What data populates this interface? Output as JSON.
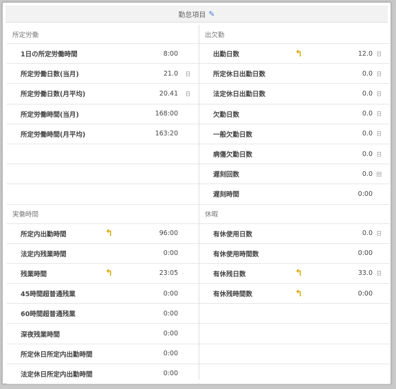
{
  "header": {
    "title": "勤怠項目"
  },
  "left": {
    "section1": {
      "title": "所定労働",
      "rows": [
        {
          "label": "1日の所定労働時間",
          "value": "8:00",
          "unit": "",
          "arrow": false
        },
        {
          "label": "所定労働日数(当月)",
          "value": "21.0",
          "unit": "日",
          "arrow": false
        },
        {
          "label": "所定労働日数(月平均)",
          "value": "20.41",
          "unit": "日",
          "arrow": false
        },
        {
          "label": "所定労働時間(当月)",
          "value": "168:00",
          "unit": "",
          "arrow": false
        },
        {
          "label": "所定労働時間(月平均)",
          "value": "163:20",
          "unit": "",
          "arrow": false
        },
        {
          "label": "",
          "value": "",
          "unit": "",
          "arrow": false
        },
        {
          "label": "",
          "value": "",
          "unit": "",
          "arrow": false
        },
        {
          "label": "",
          "value": "",
          "unit": "",
          "arrow": false
        }
      ]
    },
    "section2": {
      "title": "実働時間",
      "rows": [
        {
          "label": "所定内出勤時間",
          "value": "96:00",
          "unit": "",
          "arrow": true
        },
        {
          "label": "法定内残業時間",
          "value": "0:00",
          "unit": "",
          "arrow": false
        },
        {
          "label": "残業時間",
          "value": "23:05",
          "unit": "",
          "arrow": true
        },
        {
          "label": "45時間超普通残業",
          "value": "0:00",
          "unit": "",
          "arrow": false
        },
        {
          "label": "60時間超普通残業",
          "value": "0:00",
          "unit": "",
          "arrow": false
        },
        {
          "label": "深夜残業時間",
          "value": "0:00",
          "unit": "",
          "arrow": false
        },
        {
          "label": "所定休日所定内出勤時間",
          "value": "0:00",
          "unit": "",
          "arrow": false
        },
        {
          "label": "法定休日所定内出勤時間",
          "value": "0:00",
          "unit": "",
          "arrow": false
        }
      ]
    }
  },
  "right": {
    "section1": {
      "title": "出欠勤",
      "rows": [
        {
          "label": "出勤日数",
          "value": "12.0",
          "unit": "日",
          "arrow": true
        },
        {
          "label": "所定休日出勤日数",
          "value": "0.0",
          "unit": "日",
          "arrow": false
        },
        {
          "label": "法定休日出勤日数",
          "value": "0.0",
          "unit": "日",
          "arrow": false
        },
        {
          "label": "欠勤日数",
          "value": "0.0",
          "unit": "日",
          "arrow": false
        },
        {
          "label": "一般欠勤日数",
          "value": "0.0",
          "unit": "日",
          "arrow": false
        },
        {
          "label": "病傷欠勤日数",
          "value": "0.0",
          "unit": "日",
          "arrow": false
        },
        {
          "label": "遅刻回数",
          "value": "0.0",
          "unit": "回",
          "arrow": false
        },
        {
          "label": "遅刻時間",
          "value": "0:00",
          "unit": "",
          "arrow": false
        }
      ]
    },
    "section2": {
      "title": "休暇",
      "rows": [
        {
          "label": "有休使用日数",
          "value": "0.0",
          "unit": "日",
          "arrow": false
        },
        {
          "label": "有休使用時間数",
          "value": "0:00",
          "unit": "",
          "arrow": false
        },
        {
          "label": "有休残日数",
          "value": "33.0",
          "unit": "日",
          "arrow": true
        },
        {
          "label": "有休残時間数",
          "value": "0:00",
          "unit": "",
          "arrow": true
        },
        {
          "label": "",
          "value": "",
          "unit": "",
          "arrow": false
        },
        {
          "label": "",
          "value": "",
          "unit": "",
          "arrow": false
        },
        {
          "label": "",
          "value": "",
          "unit": "",
          "arrow": false
        },
        {
          "label": "",
          "value": "",
          "unit": "",
          "arrow": false
        }
      ]
    }
  }
}
